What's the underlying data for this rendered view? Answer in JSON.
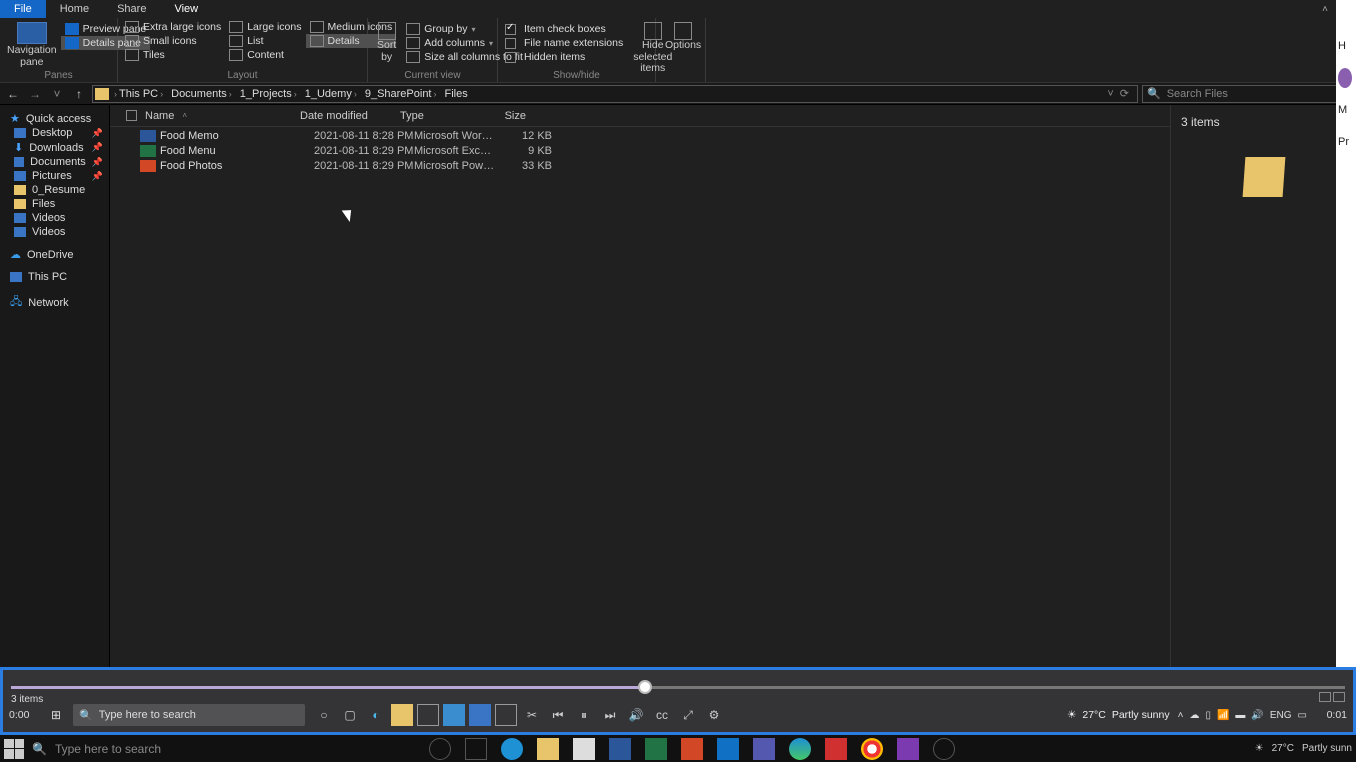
{
  "tabs": {
    "file": "File",
    "home": "Home",
    "share": "Share",
    "view": "View"
  },
  "ribbon": {
    "panes": {
      "label": "Panes",
      "navigation": "Navigation\npane",
      "preview": "Preview pane",
      "details": "Details pane"
    },
    "layout": {
      "label": "Layout",
      "extra_large": "Extra large icons",
      "large": "Large icons",
      "medium": "Medium icons",
      "small": "Small icons",
      "list": "List",
      "details": "Details",
      "tiles": "Tiles",
      "content": "Content"
    },
    "current_view": {
      "label": "Current view",
      "sort": "Sort\nby",
      "group": "Group by",
      "add_cols": "Add columns",
      "size_cols": "Size all columns to fit"
    },
    "show_hide": {
      "label": "Show/hide",
      "item_chk": "Item check boxes",
      "fne": "File name extensions",
      "hidden": "Hidden items",
      "hide_sel": "Hide selected\nitems"
    },
    "options": "Options"
  },
  "breadcrumb": [
    "This PC",
    "Documents",
    "1_Projects",
    "1_Udemy",
    "9_SharePoint",
    "Files"
  ],
  "search_placeholder": "Search Files",
  "nav": {
    "quick": "Quick access",
    "desktop": "Desktop",
    "downloads": "Downloads",
    "documents": "Documents",
    "pictures": "Pictures",
    "resume": "0_Resume",
    "files": "Files",
    "videos": "Videos",
    "videos2": "Videos",
    "onedrive": "OneDrive",
    "thispc": "This PC",
    "network": "Network"
  },
  "columns": {
    "name": "Name",
    "date": "Date modified",
    "type": "Type",
    "size": "Size"
  },
  "files": [
    {
      "icon": "word",
      "name": "Food Memo",
      "date": "2021-08-11 8:28 PM",
      "type": "Microsoft Word D...",
      "size": "12 KB"
    },
    {
      "icon": "xls",
      "name": "Food Menu",
      "date": "2021-08-11 8:29 PM",
      "type": "Microsoft Excel W...",
      "size": "9 KB"
    },
    {
      "icon": "ppt",
      "name": "Food Photos",
      "date": "2021-08-11 8:29 PM",
      "type": "Microsoft PowerP...",
      "size": "33 KB"
    }
  ],
  "details_count": "3 items",
  "video": {
    "items": "3 items",
    "time_left": "0:00",
    "time_right": "0:01",
    "search": "Type here to search",
    "weather_temp": "27°C",
    "weather_desc": "Partly sunny",
    "lang": "ENG"
  },
  "taskbar": {
    "search": "Type here to search",
    "weather_temp": "27°C",
    "weather_desc": "Partly sunn"
  },
  "sliver": {
    "h": "H",
    "m": "M",
    "p": "Pr"
  }
}
